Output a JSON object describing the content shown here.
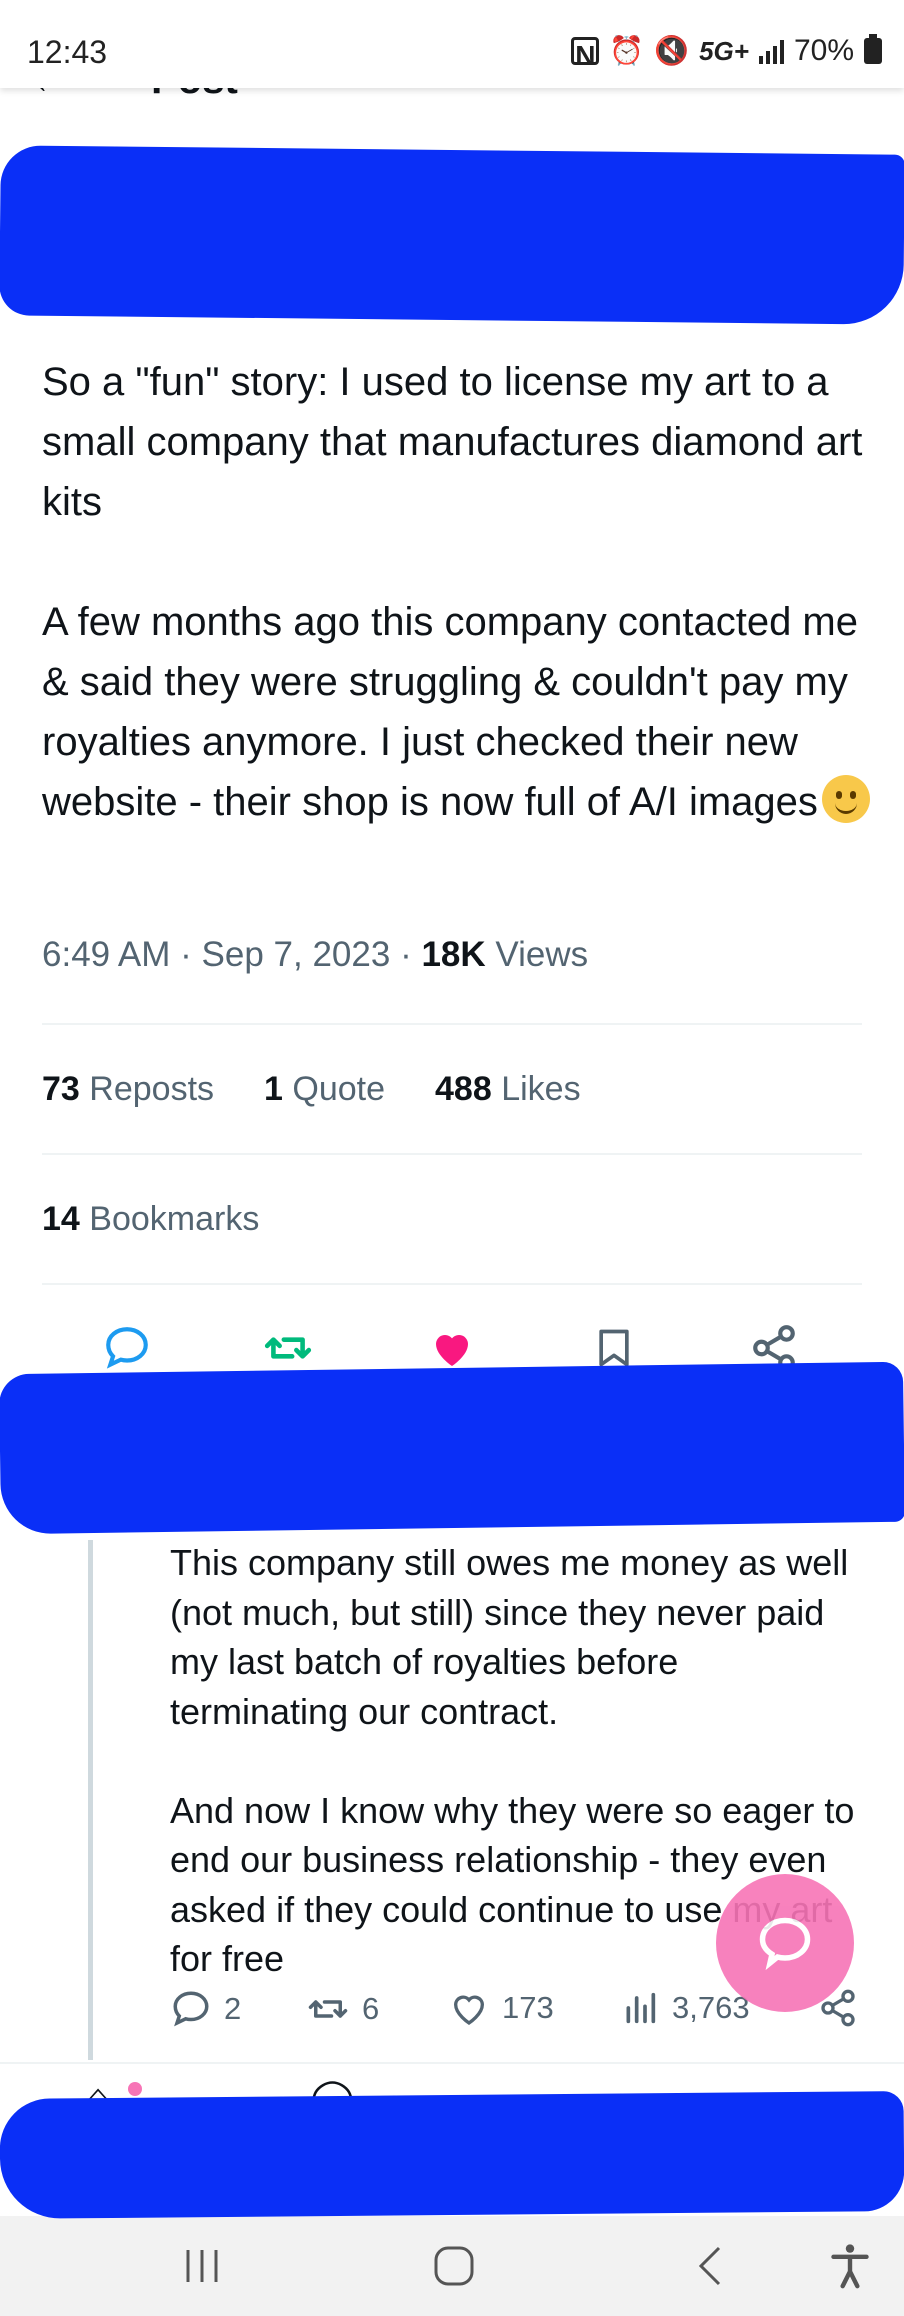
{
  "status_bar": {
    "time": "12:43",
    "network": "5G+",
    "battery": "70%",
    "icons": [
      "nfc-icon",
      "alarm-icon",
      "mute-icon",
      "signal-icon",
      "battery-icon"
    ]
  },
  "header": {
    "title": "Post"
  },
  "tweet": {
    "text": "So a \"fun\" story: I used to license my art to a small company that manufactures diamond art kits\n\nA few months ago this company contacted me & said they were struggling & couldn't pay my royalties anymore. I just checked their new website - their shop is now full of A/I images",
    "emoji": "melting-face-emoji",
    "time": "6:49 AM",
    "sep1": "·",
    "date": "Sep 7, 2023",
    "sep2": "·",
    "views_count": "18K",
    "views_label": "Views",
    "reposts_count": "73",
    "reposts_label": "Reposts",
    "quotes_count": "1",
    "quotes_label": "Quote",
    "likes_count": "488",
    "likes_label": "Likes",
    "bookmarks_count": "14",
    "bookmarks_label": "Bookmarks"
  },
  "reply": {
    "text": "This company still owes me money as well (not much, but still) since they never paid my last batch of royalties before terminating our contract.\n\nAnd now I know why they were so eager to end our business relationship - they even asked if they could continue to use my art for free",
    "replies": "2",
    "reposts": "6",
    "likes": "173",
    "views": "3,763"
  },
  "colors": {
    "accent": "#1d9bf0",
    "repost_green": "#00ba7c",
    "like_pink": "#f91880",
    "fab_pink": "#f774b6",
    "redaction_blue": "#0a2ff7"
  }
}
